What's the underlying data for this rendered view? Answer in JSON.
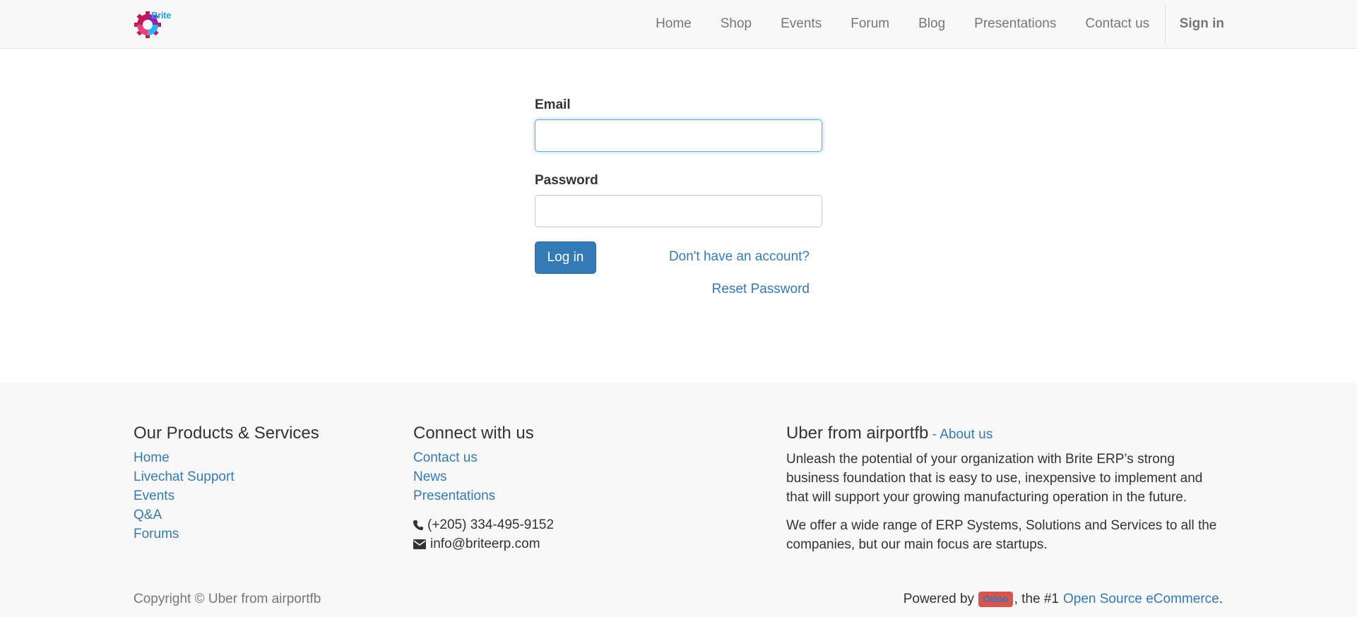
{
  "navbar": {
    "logo_text": "Brite",
    "items": [
      {
        "label": "Home"
      },
      {
        "label": "Shop"
      },
      {
        "label": "Events"
      },
      {
        "label": "Forum"
      },
      {
        "label": "Blog"
      },
      {
        "label": "Presentations"
      },
      {
        "label": "Contact us"
      }
    ],
    "signin_label": "Sign in"
  },
  "login": {
    "email_label": "Email",
    "email_value": "",
    "password_label": "Password",
    "password_value": "",
    "login_button": "Log in",
    "signup_link": "Don't have an account?",
    "reset_link": "Reset Password"
  },
  "footer": {
    "products": {
      "heading": "Our Products & Services",
      "links": [
        "Home",
        "Livechat Support",
        "Events",
        "Q&A",
        "Forums"
      ]
    },
    "connect": {
      "heading": "Connect with us",
      "links": [
        "Contact us",
        "News",
        "Presentations"
      ],
      "phone": "(+205) 334-495-9152",
      "email": "info@briteerp.com"
    },
    "about": {
      "heading": "Uber from airportfb",
      "separator": " - ",
      "about_link": "About us",
      "paragraphs": [
        "Unleash the potential of your organization with Brite ERP’s strong business foundation that is easy to use, inexpensive to implement and that will support your growing manufacturing operation in the future.",
        "We offer a wide range of ERP Systems, Solutions and Services to all the companies, but our main focus are startups."
      ]
    },
    "copyright": "Copyright © Uber from airportfb",
    "powered": {
      "prefix": "Powered by",
      "badge": "Odoo",
      "middle": ", the #1",
      "link": "Open Source eCommerce",
      "suffix": "."
    }
  },
  "colors": {
    "link": "#337ab7",
    "primary_button": "#337ab7",
    "navbar_bg": "#f8f8f8",
    "odoo_badge": "#d9534f",
    "input_focus": "#66afe9"
  }
}
